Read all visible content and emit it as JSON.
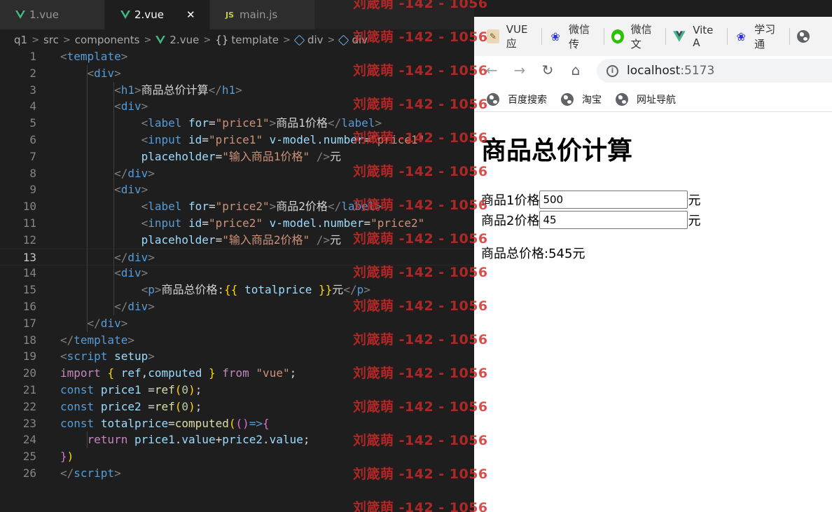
{
  "editor": {
    "tabs": [
      {
        "label": "1.vue",
        "kind": "vue",
        "active": false
      },
      {
        "label": "2.vue",
        "kind": "vue",
        "active": true
      },
      {
        "label": "main.js",
        "kind": "js",
        "active": false
      }
    ],
    "close_glyph": "✕",
    "js_badge": "JS",
    "breadcrumb": [
      "q1",
      "src",
      "components",
      "2.vue",
      "template",
      "div",
      "div"
    ],
    "current_line": 13,
    "line_numbers": [
      "1",
      "2",
      "3",
      "4",
      "5",
      "6",
      "7",
      "8",
      "9",
      "10",
      "11",
      "12",
      "13",
      "14",
      "15",
      "16",
      "17",
      "18",
      "19",
      "20",
      "21",
      "22",
      "23",
      "24",
      "25",
      "26"
    ],
    "lines": [
      [
        [
          "br",
          "<"
        ],
        [
          "tag",
          "template"
        ],
        [
          "br",
          ">"
        ]
      ],
      [
        [
          "txt",
          "    "
        ],
        [
          "br",
          "<"
        ],
        [
          "tag",
          "div"
        ],
        [
          "br",
          ">"
        ]
      ],
      [
        [
          "txt",
          "        "
        ],
        [
          "br",
          "<"
        ],
        [
          "tag",
          "h1"
        ],
        [
          "br",
          ">"
        ],
        [
          "txt",
          "商品总价计算"
        ],
        [
          "br",
          "</"
        ],
        [
          "tag",
          "h1"
        ],
        [
          "br",
          ">"
        ]
      ],
      [
        [
          "txt",
          "        "
        ],
        [
          "br",
          "<"
        ],
        [
          "tag",
          "div"
        ],
        [
          "br",
          ">"
        ]
      ],
      [
        [
          "txt",
          "            "
        ],
        [
          "br",
          "<"
        ],
        [
          "tag",
          "label"
        ],
        [
          "txt",
          " "
        ],
        [
          "attr",
          "for"
        ],
        [
          "txt",
          "="
        ],
        [
          "str",
          "\"price1\""
        ],
        [
          "br",
          ">"
        ],
        [
          "txt",
          "商品1价格"
        ],
        [
          "br",
          "</"
        ],
        [
          "tag",
          "label"
        ],
        [
          "br",
          ">"
        ]
      ],
      [
        [
          "txt",
          "            "
        ],
        [
          "br",
          "<"
        ],
        [
          "tag",
          "input"
        ],
        [
          "txt",
          " "
        ],
        [
          "attr",
          "id"
        ],
        [
          "txt",
          "="
        ],
        [
          "str",
          "\"price1\""
        ],
        [
          "txt",
          " "
        ],
        [
          "attr",
          "v-model.number"
        ],
        [
          "txt",
          "="
        ],
        [
          "str",
          "\"price1\""
        ]
      ],
      [
        [
          "txt",
          "            "
        ],
        [
          "attr",
          "placeholder"
        ],
        [
          "txt",
          "="
        ],
        [
          "str",
          "\"输入商品1价格\""
        ],
        [
          "txt",
          " "
        ],
        [
          "br",
          "/>"
        ],
        [
          "txt",
          "元"
        ]
      ],
      [
        [
          "txt",
          "        "
        ],
        [
          "br",
          "</"
        ],
        [
          "tag",
          "div"
        ],
        [
          "br",
          ">"
        ]
      ],
      [
        [
          "txt",
          "        "
        ],
        [
          "br",
          "<"
        ],
        [
          "tag",
          "div"
        ],
        [
          "br",
          ">"
        ]
      ],
      [
        [
          "txt",
          "            "
        ],
        [
          "br",
          "<"
        ],
        [
          "tag",
          "label"
        ],
        [
          "txt",
          " "
        ],
        [
          "attr",
          "for"
        ],
        [
          "txt",
          "="
        ],
        [
          "str",
          "\"price2\""
        ],
        [
          "br",
          ">"
        ],
        [
          "txt",
          "商品2价格"
        ],
        [
          "br",
          "</"
        ],
        [
          "tag",
          "label"
        ],
        [
          "br",
          ">"
        ]
      ],
      [
        [
          "txt",
          "            "
        ],
        [
          "br",
          "<"
        ],
        [
          "tag",
          "input"
        ],
        [
          "txt",
          " "
        ],
        [
          "attr",
          "id"
        ],
        [
          "txt",
          "="
        ],
        [
          "str",
          "\"price2\""
        ],
        [
          "txt",
          " "
        ],
        [
          "attr",
          "v-model.number"
        ],
        [
          "txt",
          "="
        ],
        [
          "str",
          "\"price2\""
        ]
      ],
      [
        [
          "txt",
          "            "
        ],
        [
          "attr",
          "placeholder"
        ],
        [
          "txt",
          "="
        ],
        [
          "str",
          "\"输入商品2价格\""
        ],
        [
          "txt",
          " "
        ],
        [
          "br",
          "/>"
        ],
        [
          "txt",
          "元"
        ]
      ],
      [
        [
          "txt",
          "        "
        ],
        [
          "br",
          "</"
        ],
        [
          "tag",
          "div"
        ],
        [
          "br",
          ">"
        ]
      ],
      [
        [
          "txt",
          "        "
        ],
        [
          "br",
          "<"
        ],
        [
          "tag",
          "div"
        ],
        [
          "br",
          ">"
        ]
      ],
      [
        [
          "txt",
          "            "
        ],
        [
          "br",
          "<"
        ],
        [
          "tag",
          "p"
        ],
        [
          "br",
          ">"
        ],
        [
          "txt",
          "商品总价格:"
        ],
        [
          "b1",
          "{{"
        ],
        [
          "txt",
          " "
        ],
        [
          "var",
          "totalprice"
        ],
        [
          "txt",
          " "
        ],
        [
          "b1",
          "}}"
        ],
        [
          "txt",
          "元"
        ],
        [
          "br",
          "</"
        ],
        [
          "tag",
          "p"
        ],
        [
          "br",
          ">"
        ]
      ],
      [
        [
          "txt",
          "        "
        ],
        [
          "br",
          "</"
        ],
        [
          "tag",
          "div"
        ],
        [
          "br",
          ">"
        ]
      ],
      [
        [
          "txt",
          "    "
        ],
        [
          "br",
          "</"
        ],
        [
          "tag",
          "div"
        ],
        [
          "br",
          ">"
        ]
      ],
      [
        [
          "br",
          "</"
        ],
        [
          "tag",
          "template"
        ],
        [
          "br",
          ">"
        ]
      ],
      [
        [
          "br",
          "<"
        ],
        [
          "tag",
          "script"
        ],
        [
          "txt",
          " "
        ],
        [
          "attr",
          "setup"
        ],
        [
          "br",
          ">"
        ]
      ],
      [
        [
          "kw",
          "import"
        ],
        [
          "txt",
          " "
        ],
        [
          "b1",
          "{"
        ],
        [
          "txt",
          " "
        ],
        [
          "var",
          "ref"
        ],
        [
          "txt",
          ","
        ],
        [
          "var",
          "computed"
        ],
        [
          "txt",
          " "
        ],
        [
          "b1",
          "}"
        ],
        [
          "txt",
          " "
        ],
        [
          "kw",
          "from"
        ],
        [
          "txt",
          " "
        ],
        [
          "str",
          "\"vue\""
        ],
        [
          "txt",
          ";"
        ]
      ],
      [
        [
          "kb",
          "const"
        ],
        [
          "txt",
          " "
        ],
        [
          "var",
          "price1"
        ],
        [
          "txt",
          " ="
        ],
        [
          "fn",
          "ref"
        ],
        [
          "b1",
          "("
        ],
        [
          "num",
          "0"
        ],
        [
          "b1",
          ")"
        ],
        [
          "txt",
          ";"
        ]
      ],
      [
        [
          "kb",
          "const"
        ],
        [
          "txt",
          " "
        ],
        [
          "var",
          "price2"
        ],
        [
          "txt",
          " ="
        ],
        [
          "fn",
          "ref"
        ],
        [
          "b1",
          "("
        ],
        [
          "num",
          "0"
        ],
        [
          "b1",
          ")"
        ],
        [
          "txt",
          ";"
        ]
      ],
      [
        [
          "kb",
          "const"
        ],
        [
          "txt",
          " "
        ],
        [
          "var",
          "totalprice"
        ],
        [
          "txt",
          "="
        ],
        [
          "fn",
          "computed"
        ],
        [
          "b1",
          "("
        ],
        [
          "b2",
          "()"
        ],
        [
          "kb",
          "=>"
        ],
        [
          "b2",
          "{"
        ]
      ],
      [
        [
          "txt",
          "    "
        ],
        [
          "kw",
          "return"
        ],
        [
          "txt",
          " "
        ],
        [
          "var",
          "price1"
        ],
        [
          "txt",
          "."
        ],
        [
          "var",
          "value"
        ],
        [
          "txt",
          "+"
        ],
        [
          "var",
          "price2"
        ],
        [
          "txt",
          "."
        ],
        [
          "var",
          "value"
        ],
        [
          "txt",
          ";"
        ]
      ],
      [
        [
          "b2",
          "}"
        ],
        [
          "b1",
          ")"
        ]
      ],
      [
        [
          "br",
          "</"
        ],
        [
          "tag",
          "script"
        ],
        [
          "br",
          ">"
        ]
      ]
    ]
  },
  "browser": {
    "bookmarks_top": [
      {
        "label": "VUE应",
        "icon": "vue-bookmark-icon"
      },
      {
        "label": "微信传",
        "icon": "baidu-paw-icon"
      },
      {
        "label": "微信文",
        "icon": "wechat-icon"
      },
      {
        "label": "Vite A",
        "icon": "vite-icon"
      },
      {
        "label": "学习通",
        "icon": "baidu-paw-icon"
      }
    ],
    "url_host": "localhost",
    "url_port": ":5173",
    "bookmarks_bottom": [
      {
        "label": "百度搜索",
        "icon": "globe-icon"
      },
      {
        "label": "淘宝",
        "icon": "globe-icon"
      },
      {
        "label": "网址导航",
        "icon": "globe-icon"
      }
    ],
    "page": {
      "title": "商品总价计算",
      "label1": "商品1价格",
      "input1_value": "500",
      "input1_placeholder": "输入商品1价格",
      "unit1": "元",
      "label2": "商品2价格",
      "input2_value": "45",
      "input2_placeholder": "输入商品2价格",
      "unit2": "元",
      "total_prefix": "商品总价格:",
      "total_value": "545",
      "total_unit": "元"
    }
  },
  "watermark": {
    "text": "刘箴萌 -142 - 1056",
    "count": 16
  }
}
